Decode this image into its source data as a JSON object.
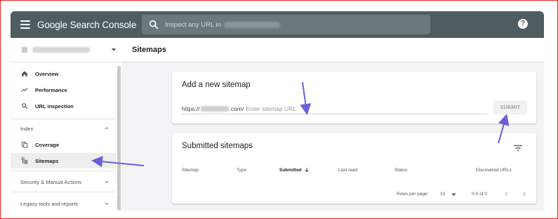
{
  "header": {
    "app_title": "Google Search Console",
    "search_placeholder": "Inspect any URL in"
  },
  "sidebar": {
    "items": [
      {
        "label": "Overview",
        "icon": "home-icon"
      },
      {
        "label": "Performance",
        "icon": "trending-up-icon"
      },
      {
        "label": "URL inspection",
        "icon": "search-icon"
      }
    ],
    "index_section": "Index",
    "index_items": [
      {
        "label": "Coverage",
        "icon": "copy-icon"
      },
      {
        "label": "Sitemaps",
        "icon": "sitemap-icon",
        "active": true
      }
    ],
    "security_section": "Security & Manual Actions",
    "legacy_section": "Legacy tools and reports"
  },
  "main": {
    "page_title": "Sitemaps",
    "add_card": {
      "title": "Add a new sitemap",
      "url_prefix": "https://",
      "url_suffix": ".com/",
      "input_placeholder": "Enter sitemap URL",
      "submit_label": "SUBMIT"
    },
    "submitted_card": {
      "title": "Submitted sitemaps",
      "columns": [
        "Sitemap",
        "Type",
        "Submitted",
        "Last read",
        "Status",
        "Discovered URLs"
      ],
      "rows_per_page_label": "Rows per page:",
      "rows_per_page_value": "10",
      "range_text": "0-0 of 0"
    }
  },
  "colors": {
    "topbar": "#4f5d63",
    "annotation_arrow": "#6a5fd8",
    "frame_border": "#e8231f"
  }
}
